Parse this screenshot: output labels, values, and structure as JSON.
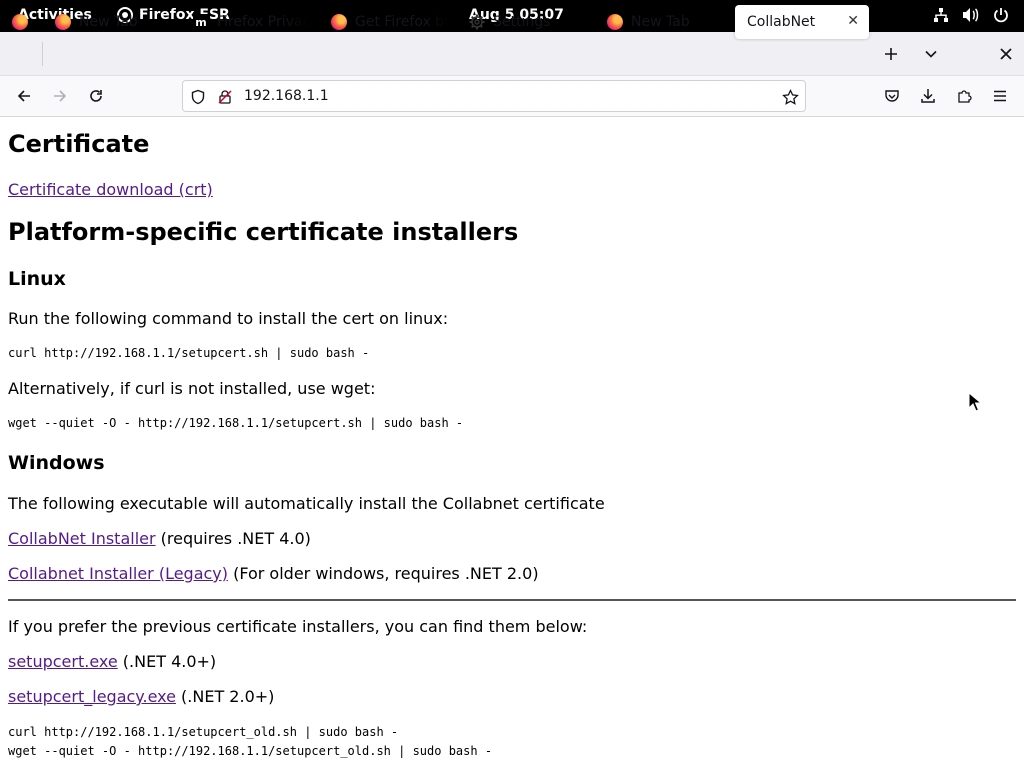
{
  "system_bar": {
    "activities": "Activities",
    "app_name": "Firefox ESR",
    "clock": "Aug 5  05:07"
  },
  "tabs": [
    {
      "label": "",
      "icon": "firefox-icon"
    },
    {
      "label": "New Tab",
      "icon": "firefox-icon"
    },
    {
      "label": "Firefox Privacy",
      "icon": "m-icon"
    },
    {
      "label": "Get Firefox bro",
      "icon": "firefox-icon"
    },
    {
      "label": "Settings",
      "icon": "gear-icon"
    },
    {
      "label": "New Tab",
      "icon": "firefox-icon"
    },
    {
      "label": "CollabNet",
      "icon": "",
      "active": true
    }
  ],
  "navbar": {
    "url": "192.168.1.1"
  },
  "page": {
    "title": "Certificate",
    "cert_download_link": "Certificate download (crt)",
    "installers_heading": "Platform-specific certificate installers",
    "linux_heading": "Linux",
    "linux_intro": "Run the following command to install the cert on linux:",
    "linux_curl_cmd": "curl http://192.168.1.1/setupcert.sh | sudo bash -",
    "linux_alt": "Alternatively, if curl is not installed, use wget:",
    "linux_wget_cmd": "wget --quiet -O - http://192.168.1.1/setupcert.sh | sudo bash -",
    "windows_heading": "Windows",
    "windows_intro": "The following executable will automatically install the Collabnet certificate",
    "installer_link": "CollabNet Installer",
    "installer_note": " (requires .NET 4.0)",
    "legacy_installer_link": "Collabnet Installer (Legacy)",
    "legacy_installer_note": " (For older windows, requires .NET 2.0)",
    "previous_intro": "If you prefer the previous certificate installers, you can find them below:",
    "setupcert_link": "setupcert.exe",
    "setupcert_note": " (.NET 4.0+)",
    "setupcert_legacy_link": "setupcert_legacy.exe",
    "setupcert_legacy_note": " (.NET 2.0+)",
    "old_curl_cmd": "curl http://192.168.1.1/setupcert_old.sh | sudo bash -",
    "old_wget_cmd": "wget --quiet -O - http://192.168.1.1/setupcert_old.sh | sudo bash -"
  },
  "colors": {
    "link": "#551a8b",
    "tabstrip": "#f0f0f4",
    "topbar": "#000000"
  }
}
